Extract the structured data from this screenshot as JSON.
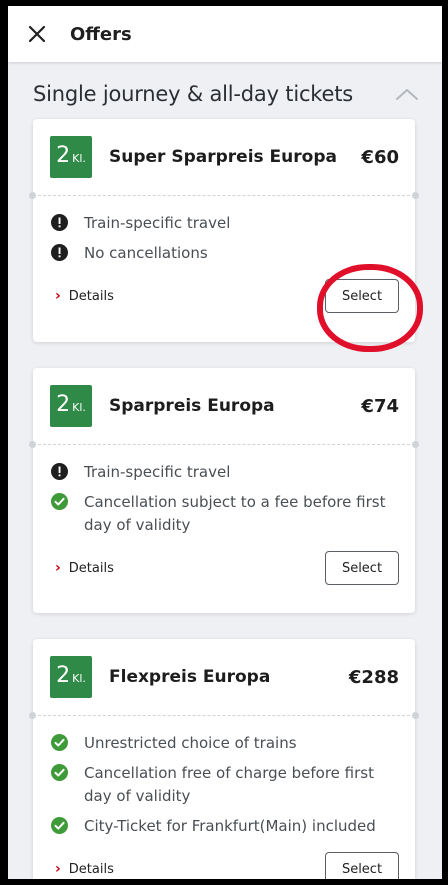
{
  "header": {
    "title": "Offers",
    "close_icon": "close-icon"
  },
  "section": {
    "title": "Single journey & all-day tickets",
    "toggle_icon": "chevron-up-icon"
  },
  "offers": [
    {
      "class_num": "2",
      "class_suffix": "Kl.",
      "name": "Super Sparpreis Europa",
      "price": "€60",
      "features": [
        {
          "icon": "warn",
          "text": "Train-specific travel"
        },
        {
          "icon": "warn",
          "text": "No cancellations"
        }
      ],
      "details_label": "Details",
      "select_label": "Select"
    },
    {
      "class_num": "2",
      "class_suffix": "Kl.",
      "name": "Sparpreis Europa",
      "price": "€74",
      "features": [
        {
          "icon": "warn",
          "text": "Train-specific travel"
        },
        {
          "icon": "ok",
          "text": "Cancellation subject to a fee before first day of validity"
        }
      ],
      "details_label": "Details",
      "select_label": "Select"
    },
    {
      "class_num": "2",
      "class_suffix": "Kl.",
      "name": "Flexpreis Europa",
      "price": "€288",
      "features": [
        {
          "icon": "ok",
          "text": "Unrestricted choice of trains"
        },
        {
          "icon": "ok",
          "text": "Cancellation free of charge before first day of validity"
        },
        {
          "icon": "ok",
          "text": "City-Ticket for Frankfurt(Main) included"
        }
      ],
      "details_label": "Details",
      "select_label": "Select"
    }
  ],
  "colors": {
    "class_badge": "#2f8a47",
    "ok_icon": "#3f9a3a",
    "accent_red": "#c50014",
    "annotation_ring": "#e0102a"
  }
}
